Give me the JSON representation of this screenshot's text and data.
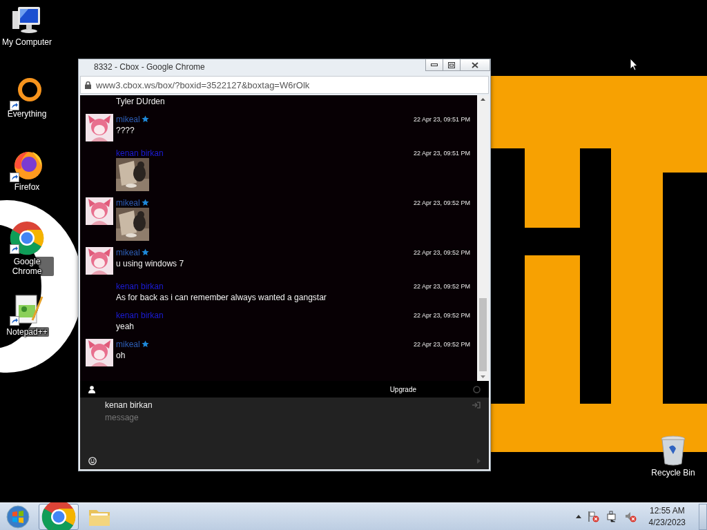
{
  "desktop_icons": [
    {
      "label": "My Computer",
      "kind": "computer",
      "shortcut": false
    },
    {
      "label": "Everything",
      "kind": "everything",
      "shortcut": true
    },
    {
      "label": "Firefox",
      "kind": "firefox",
      "shortcut": true
    },
    {
      "label": "Google Chrome",
      "kind": "chrome",
      "shortcut": true
    },
    {
      "label": "Notepad++",
      "kind": "notepad",
      "shortcut": true
    }
  ],
  "recycle_bin": {
    "label": "Recycle Bin"
  },
  "window": {
    "title": "8332 - Cbox - Google Chrome",
    "url": "www3.cbox.ws/box/?boxid=3522127&boxtag=W6rOlk"
  },
  "chat": {
    "messages": [
      {
        "kind": "text",
        "avatar": false,
        "text": "Tyler DUrden"
      },
      {
        "kind": "text",
        "author": "mikeal",
        "color": "#2e5fb8",
        "avatar": true,
        "starred": true,
        "time": "22 Apr 23, 09:51 PM",
        "text": "????"
      },
      {
        "author": "kenan birkan",
        "color": "#1c1cd8",
        "avatar": false,
        "starred": false,
        "time": "22 Apr 23, 09:51 PM"
      },
      {
        "author": "mikeal",
        "color": "#2e5fb8",
        "avatar": true,
        "starred": true,
        "time": "22 Apr 23, 09:52 PM"
      },
      {
        "kind": "text",
        "author": "mikeal",
        "color": "#2e5fb8",
        "avatar": true,
        "starred": true,
        "time": "22 Apr 23, 09:52 PM",
        "text": "u using windows 7"
      },
      {
        "kind": "text",
        "author": "kenan birkan",
        "color": "#1c1cd8",
        "avatar": false,
        "starred": false,
        "time": "22 Apr 23, 09:52 PM",
        "text": "As for back as i can remember always wanted a gangstar"
      },
      {
        "kind": "text",
        "author": "kenan birkan",
        "color": "#1c1cd8",
        "avatar": false,
        "starred": false,
        "time": "22 Apr 23, 09:52 PM",
        "text": "yeah"
      },
      {
        "kind": "text",
        "author": "mikeal",
        "color": "#2e5fb8",
        "avatar": true,
        "starred": true,
        "time": "22 Apr 23, 09:52 PM",
        "text": "oh"
      }
    ]
  },
  "toolbar": {
    "upgrade": "Upgrade"
  },
  "composer": {
    "name": "kenan birkan",
    "placeholder": "message"
  },
  "taskbar": {
    "time": "12:55 AM",
    "date": "4/23/2023"
  }
}
